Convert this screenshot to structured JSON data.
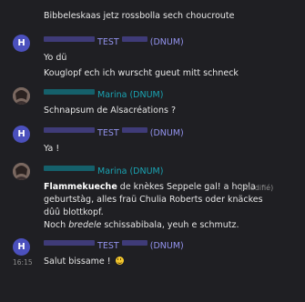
{
  "messages": [
    {
      "text": "Bibbeleskaas jetz rossbolla sech choucroute"
    },
    {
      "avatar_letter": "H",
      "sender_name": "TEST",
      "sender_suffix": "(DNUM)",
      "lines": [
        "Yo dü",
        "Kouglopf ech ich wurscht gueut mitt schneck"
      ]
    },
    {
      "sender_name": "Marina (DNUM)",
      "lines": [
        "Schnapsum de Alsacréations ?"
      ]
    },
    {
      "avatar_letter": "H",
      "sender_name": "TEST",
      "sender_suffix": "(DNUM)",
      "lines": [
        "Ya !"
      ]
    },
    {
      "sender_name": "Marina (DNUM)",
      "edited_label": "(modifié)",
      "line1_bold": "Flammekueche",
      "line1_rest": " de knèkes Seppele gal! a hopla",
      "line2": "geburtstàg, alles fraü Chulia Roberts oder knäckes",
      "line3": "dûû blottkopf.",
      "line4_start": "Noch ",
      "line4_italic": "bredele",
      "line4_end": " schissabibala, yeuh e schmutz."
    },
    {
      "avatar_letter": "H",
      "sender_name": "TEST",
      "sender_suffix": "(DNUM)",
      "time": "16:15",
      "text": "Salut bissame !",
      "emoji": "grinning-face"
    }
  ],
  "colors": {
    "background": "#1f1f23",
    "text": "#e6e6e6",
    "avatar_h": "#4b50bd",
    "sender_violet": "#9393ee",
    "sender_teal": "#1aa3b2",
    "muted": "#8b8b8b"
  }
}
